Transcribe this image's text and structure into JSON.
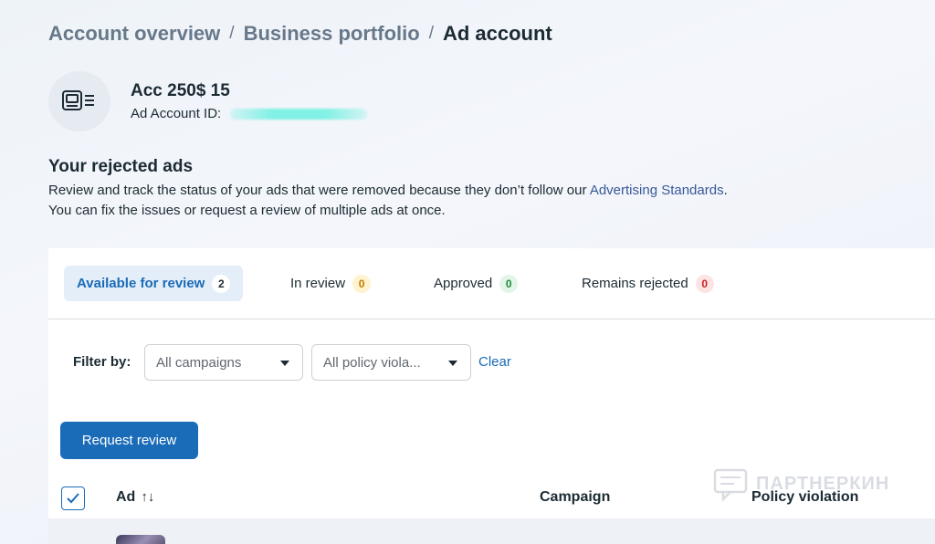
{
  "breadcrumb": {
    "items": [
      "Account overview",
      "Business portfolio"
    ],
    "separator": "/",
    "current": "Ad account"
  },
  "account": {
    "name": "Acc 250$ 15",
    "id_label": "Ad Account ID:"
  },
  "section": {
    "title": "Your rejected ads",
    "desc_line1_before": "Review and track the status of your ads that were removed because they don’t follow our ",
    "desc_link": "Advertising Standards",
    "desc_line1_after": ".",
    "desc_line2": "You can fix the issues or request a review of multiple ads at once."
  },
  "tabs": [
    {
      "label": "Available for review",
      "count": "2"
    },
    {
      "label": "In review",
      "count": "0"
    },
    {
      "label": "Approved",
      "count": "0"
    },
    {
      "label": "Remains rejected",
      "count": "0"
    }
  ],
  "filter": {
    "label": "Filter by:",
    "campaigns_value": "All campaigns",
    "policy_value": "All policy viola...",
    "clear_label": "Clear"
  },
  "actions": {
    "request_review_label": "Request review"
  },
  "table": {
    "columns": {
      "ad": "Ad",
      "ad_sort_icon": "↑↓",
      "campaign": "Campaign",
      "policy": "Policy violation"
    }
  },
  "watermark": {
    "text": "ПАРТНЕРКИН"
  },
  "colors": {
    "accent": "#1a6bb8",
    "link": "#385898",
    "warn": "#c27a00",
    "ok": "#1e8a3b",
    "bad": "#c81e1e"
  }
}
